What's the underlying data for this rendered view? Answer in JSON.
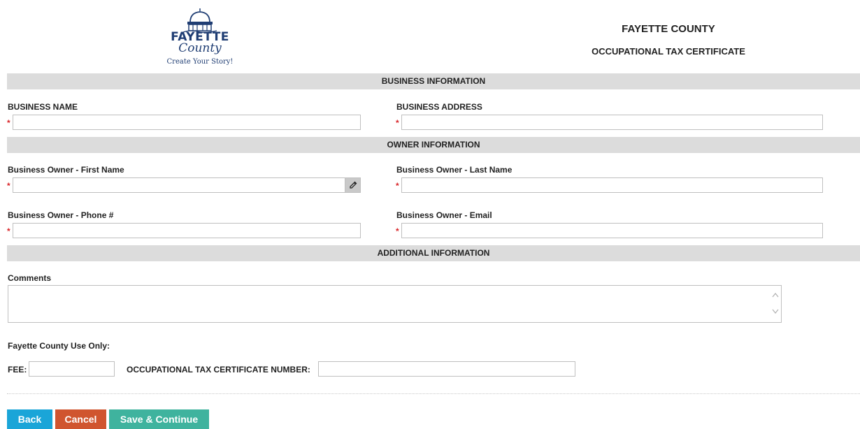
{
  "logo": {
    "word": "FAYETTE",
    "county": "County",
    "tagline": "Create Your Story!"
  },
  "header": {
    "title": "FAYETTE COUNTY",
    "subtitle": "OCCUPATIONAL TAX CERTIFICATE"
  },
  "sections": {
    "business": "BUSINESS INFORMATION",
    "owner": "OWNER INFORMATION",
    "additional": "ADDITIONAL INFORMATION"
  },
  "fields": {
    "business_name": {
      "label": "BUSINESS NAME",
      "value": ""
    },
    "business_address": {
      "label": "BUSINESS ADDRESS",
      "value": ""
    },
    "owner_first": {
      "label": "Business Owner - First Name",
      "value": ""
    },
    "owner_last": {
      "label": "Business Owner - Last Name",
      "value": ""
    },
    "owner_phone": {
      "label": "Business Owner - Phone #",
      "value": ""
    },
    "owner_email": {
      "label": "Business Owner - Email",
      "value": ""
    },
    "comments": {
      "label": "Comments",
      "value": ""
    }
  },
  "required_marker": "*",
  "county_use": {
    "heading": "Fayette County Use Only:",
    "fee_label": "FEE:",
    "fee_value": "",
    "cert_label": "OCCUPATIONAL TAX CERTIFICATE NUMBER:",
    "cert_value": ""
  },
  "buttons": {
    "back": "Back",
    "cancel": "Cancel",
    "save": "Save & Continue"
  },
  "colors": {
    "back": "#1aa5d8",
    "cancel": "#d0552f",
    "save": "#3fb39e",
    "required": "#d9262a",
    "section_bg": "#dcdcdc",
    "logo_blue": "#1f3d73"
  },
  "icons": {
    "picker": "eyedropper-icon",
    "scroll_up": "chevron-up-icon",
    "scroll_down": "chevron-down-icon"
  }
}
